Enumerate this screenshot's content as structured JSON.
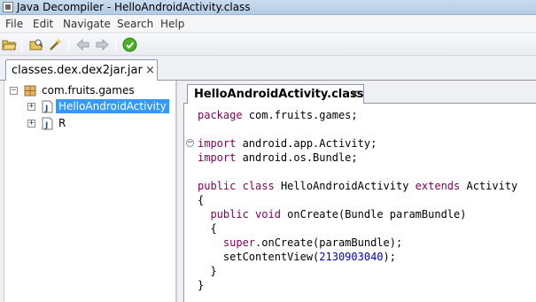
{
  "window": {
    "title": "Java Decompiler - HelloAndroidActivity.class"
  },
  "menu": [
    "File",
    "Edit",
    "Navigate",
    "Search",
    "Help"
  ],
  "toolbar": {
    "buttons": [
      "open-folder-icon",
      "open-type-icon",
      "wand-icon",
      "back-arrow-icon",
      "forward-arrow-icon",
      "check-icon"
    ]
  },
  "file_tab": {
    "label": "classes.dex.dex2jar.jar",
    "close": "×"
  },
  "tree": {
    "package": {
      "label": "com.fruits.games",
      "expander": "−"
    },
    "classes": [
      {
        "label": "HelloAndroidActivity",
        "expander": "+",
        "selected": true
      },
      {
        "label": "R",
        "expander": "+",
        "selected": false
      }
    ]
  },
  "editor_tab": {
    "label": "HelloAndroidActivity.class",
    "close": "×"
  },
  "code": {
    "fold_marker": "−",
    "lines": [
      [
        {
          "t": "package",
          "c": "kw"
        },
        {
          "t": " com.fruits.games;"
        }
      ],
      [],
      [
        {
          "t": "import",
          "c": "kw"
        },
        {
          "t": " android.app.Activity;"
        }
      ],
      [
        {
          "t": "import",
          "c": "kw"
        },
        {
          "t": " android.os.Bundle;"
        }
      ],
      [],
      [
        {
          "t": "public",
          "c": "kw"
        },
        {
          "t": " "
        },
        {
          "t": "class",
          "c": "kw"
        },
        {
          "t": " HelloAndroidActivity "
        },
        {
          "t": "extends",
          "c": "kw"
        },
        {
          "t": " Activity"
        }
      ],
      [
        {
          "t": "{"
        }
      ],
      [
        {
          "t": "  "
        },
        {
          "t": "public",
          "c": "kw"
        },
        {
          "t": " "
        },
        {
          "t": "void",
          "c": "kw"
        },
        {
          "t": " onCreate(Bundle paramBundle)"
        }
      ],
      [
        {
          "t": "  {"
        }
      ],
      [
        {
          "t": "    "
        },
        {
          "t": "super",
          "c": "kw"
        },
        {
          "t": ".onCreate(paramBundle);"
        }
      ],
      [
        {
          "t": "    setContentView("
        },
        {
          "t": "2130903040",
          "c": "num"
        },
        {
          "t": ");"
        }
      ],
      [
        {
          "t": "  }"
        }
      ],
      [
        {
          "t": "}"
        }
      ]
    ]
  }
}
